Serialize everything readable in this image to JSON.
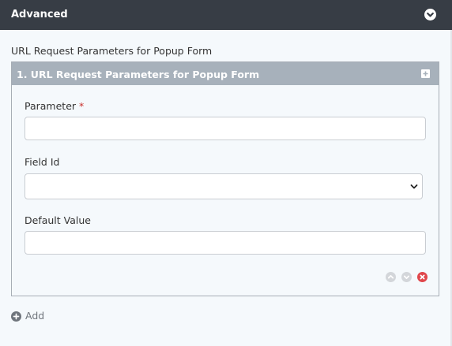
{
  "header": {
    "title": "Advanced",
    "toggle_icon": "chevron-down-circle-icon"
  },
  "section": {
    "label": "URL Request Parameters for Popup Form"
  },
  "repeater": {
    "item_title": "1. URL Request Parameters for Popup Form",
    "expand_icon": "plus-square-icon",
    "fields": {
      "parameter_label": "Parameter",
      "parameter_required_mark": "*",
      "parameter_value": "",
      "field_id_label": "Field Id",
      "field_id_selected": "",
      "default_value_label": "Default Value",
      "default_value_value": ""
    },
    "controls": [
      "move-up-icon",
      "move-down-icon",
      "remove-icon"
    ]
  },
  "add": {
    "label": "Add",
    "icon": "plus-circle-icon"
  },
  "colors": {
    "header_bg": "#373d45",
    "repeater_head_bg": "#a7b1bb",
    "panel_bg": "#f5f9fc",
    "remove": "#e0474c",
    "required": "#c9302c"
  }
}
